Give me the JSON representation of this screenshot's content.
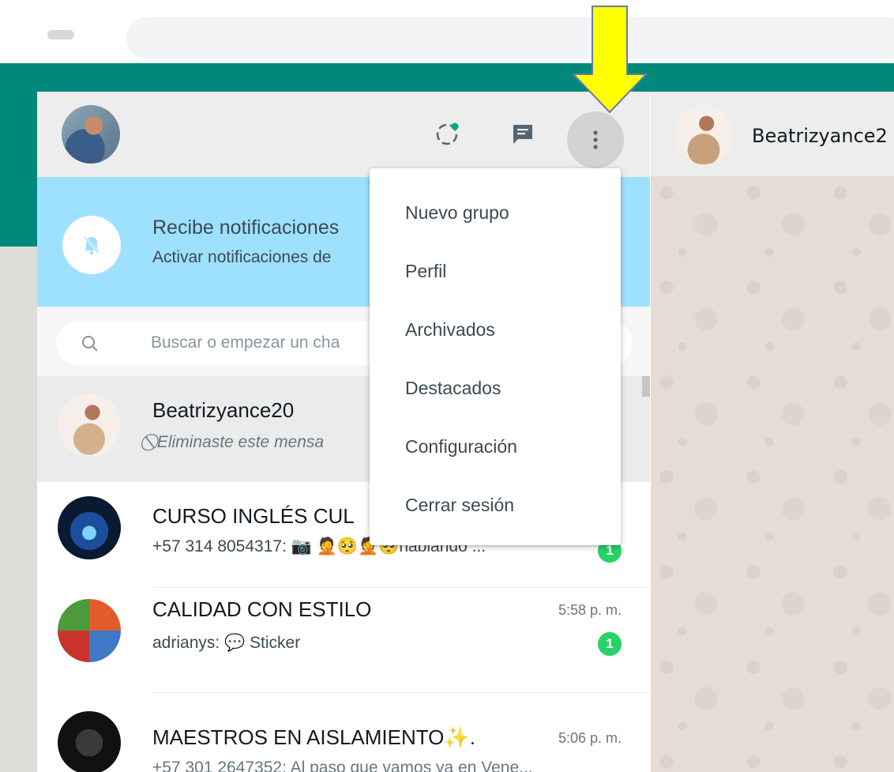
{
  "app": {
    "accent_color": "#00897b",
    "badge_color": "#25d366",
    "annotation_color": "#ffff00"
  },
  "header": {
    "status_icon": "status-icon",
    "new_chat_icon": "new-chat-icon",
    "menu_icon": "vertical-dots-icon"
  },
  "notification": {
    "title": "Recibe notificaciones",
    "subtitle": "Activar notificaciones de"
  },
  "search": {
    "placeholder": "Buscar o empezar un cha"
  },
  "chats": [
    {
      "name": "Beatrizyance20",
      "message": "Eliminaste este mensa",
      "time": "",
      "unread": ""
    },
    {
      "name": "CURSO INGLÉS CUL",
      "message": "+57 314 8054317: 📷 🤦🥺🤦🥺hablando ...",
      "time": "",
      "unread": "1"
    },
    {
      "name": "CALIDAD CON ESTILO",
      "message": "adrianys: 💬 Sticker",
      "time": "5:58 p. m.",
      "unread": "1"
    },
    {
      "name": "MAESTROS EN AISLAMIENTO✨.",
      "message": "+57 301 2647352: Al paso que vamos ya en Vene...",
      "time": "5:06 p. m.",
      "unread": ""
    }
  ],
  "conversation": {
    "contact_name": "Beatrizyance2"
  },
  "menu": {
    "items": [
      "Nuevo grupo",
      "Perfil",
      "Archivados",
      "Destacados",
      "Configuración",
      "Cerrar sesión"
    ]
  }
}
